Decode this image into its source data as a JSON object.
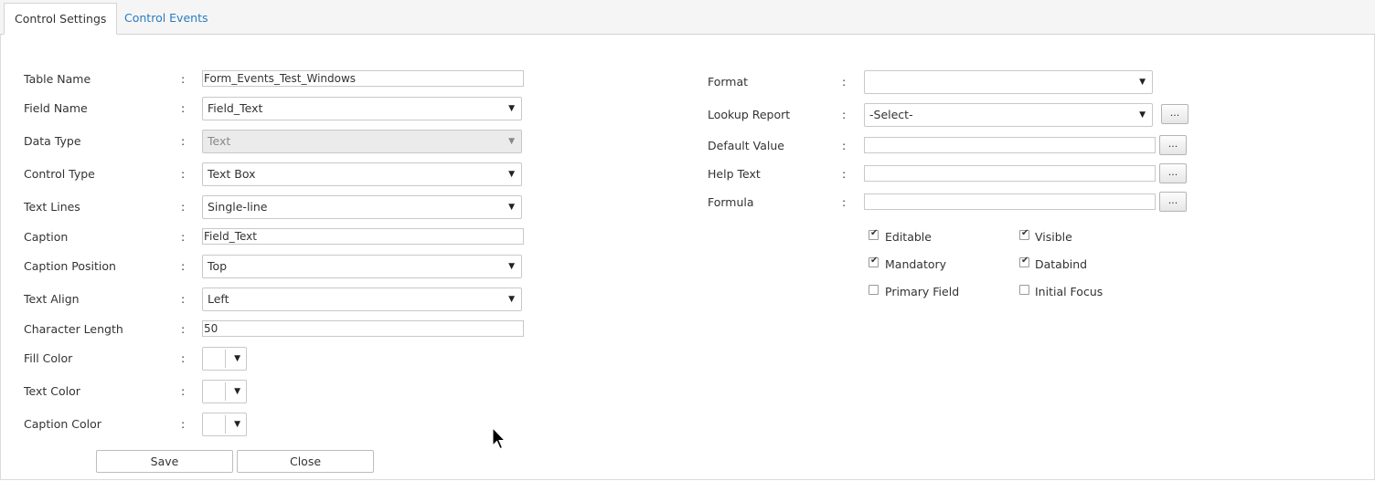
{
  "tabs": [
    {
      "label": "Control Settings",
      "active": true
    },
    {
      "label": "Control Events",
      "active": false
    }
  ],
  "left_fields": {
    "table_name": {
      "label": "Table Name",
      "value": "Form_Events_Test_Windows"
    },
    "field_name": {
      "label": "Field Name",
      "value": "Field_Text"
    },
    "data_type": {
      "label": "Data Type",
      "value": "Text"
    },
    "control_type": {
      "label": "Control Type",
      "value": "Text Box"
    },
    "text_lines": {
      "label": "Text Lines",
      "value": "Single-line"
    },
    "caption": {
      "label": "Caption",
      "value": "Field_Text"
    },
    "caption_position": {
      "label": "Caption Position",
      "value": "Top"
    },
    "text_align": {
      "label": "Text Align",
      "value": "Left"
    },
    "character_length": {
      "label": "Character Length",
      "value": "50"
    },
    "fill_color": {
      "label": "Fill Color"
    },
    "text_color": {
      "label": "Text Color"
    },
    "caption_color": {
      "label": "Caption Color"
    }
  },
  "right_fields": {
    "format": {
      "label": "Format",
      "value": ""
    },
    "lookup_report": {
      "label": "Lookup Report",
      "value": "-Select-"
    },
    "default_value": {
      "label": "Default Value",
      "value": ""
    },
    "help_text": {
      "label": "Help Text",
      "value": ""
    },
    "formula": {
      "label": "Formula",
      "value": ""
    }
  },
  "checkboxes": {
    "editable": {
      "label": "Editable",
      "checked": true
    },
    "visible": {
      "label": "Visible",
      "checked": true
    },
    "mandatory": {
      "label": "Mandatory",
      "checked": true
    },
    "databind": {
      "label": "Databind",
      "checked": true
    },
    "primary_field": {
      "label": "Primary Field",
      "checked": false
    },
    "initial_focus": {
      "label": "Initial Focus",
      "checked": false
    }
  },
  "colon": ":",
  "dropdown_glyph": "▼",
  "ellipsis_label": "...",
  "check_glyph": "✔",
  "buttons": {
    "save": "Save",
    "close": "Close"
  }
}
